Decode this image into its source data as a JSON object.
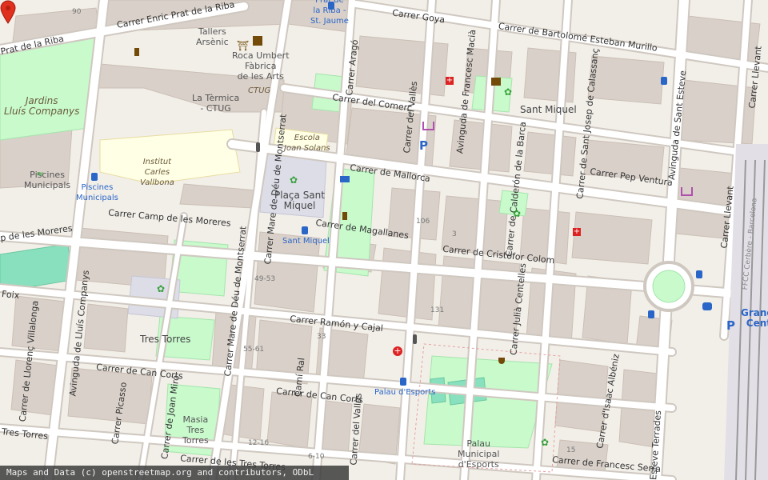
{
  "attribution": "Maps and Data (c) openstreetmap.org and contributors, ODbL",
  "streets": {
    "goya": "Carrer Goya",
    "enric_prat": "Carrer Enric Prat de la Riba",
    "prat_riba_left": "Prat de la Riba",
    "bartolome": "Carrer de Bartolomé Esteban Murillo",
    "comerc": "Carrer del Comerç",
    "mallorca": "Carrer de Mallorca",
    "pep_ventura": "Carrer Pep Ventura",
    "moreres": "Carrer Camp de les Moreres",
    "moreres_left": "p de les Moreres",
    "magallanes": "Carrer de Magallanes",
    "cristofor": "Carrer de Cristòfor Colom",
    "ramon_cajal": "Carrer Ramón y Cajal",
    "can_corts_w": "Carrer de Can Corts",
    "can_corts_e": "Carrer de Can Corts",
    "tres_torres_row": "Carrer de les Tres Torres",
    "tres_torres_left": "Tres Torres",
    "francesc_serra": "Carrer de Francesc Serra",
    "foix": "Foix",
    "arago": "Carrer Aragó",
    "valles_n": "Carrer del Vallès",
    "valles_s": "Carrer del Vallès",
    "macia": "Avinguda de Francesc Macià",
    "calderon": "Carrer de Calderón de la Barca",
    "josep_calassanc": "Carrer de Sant Josep de Calassanç",
    "sant_esteve": "Avinguda de Sant Esteve",
    "llevant_n": "Carrer Llevant",
    "llevant_s": "Carrer Llevant",
    "montserrat_n": "Carrer Mare de Déu de Montserrat",
    "montserrat_s": "Carrer Mare de Déu de Montserrat",
    "cami_ral": "Camí Ral",
    "julia": "Carrer Julià Centelles",
    "isaac": "Carrer d'Isaac Albéniz",
    "joan_miro": "Carrer de Joan Miró",
    "picasso": "Carrer Picasso",
    "lluis_companys": "Avinguda de Lluís Companys",
    "llorenc": "Carrer de Llorenç Villalonga",
    "terrades": "Esteve Terrades"
  },
  "places": {
    "tallers": "Tallers\nArsènic",
    "roca": "Roca Umbert\nFàbrica\nde les Arts",
    "ctug_term": "La Tèrmica\n- CTUG",
    "ctug": "CTUG",
    "jardins": "Jardins\nLluís Companys",
    "escola": "Escola\nJoan Solans",
    "institut": "Institut\nCarles\nVallbona",
    "piscines": "Piscines\nMunicipals",
    "placa": "Plaça Sant\nMiquel",
    "sant_miquel_area": "Sant Miquel",
    "tres_torres": "Tres Torres",
    "masia": "Masia\nTres\nTorres",
    "palau": "Palau\nMunicipal\nd'Esports",
    "granollers": "Granol\nCent"
  },
  "stops": {
    "prat_riba": "Prat de\nla Riba -\nSt. Jaume",
    "piscines": "Piscines\nMunicipals",
    "sant_miquel": "Sant Miquel",
    "palau": "Palau d'Esports"
  },
  "numbers": {
    "n90": "90",
    "n106": "106",
    "n3": "3",
    "n131": "131",
    "n4953": "49-53",
    "n33": "33",
    "n5561": "55-61",
    "n1216": "12-16",
    "n610": "6-10",
    "n15": "15"
  },
  "railway": "FFCC Cerbère - Barcelona",
  "colors": {
    "land": "#f2efe9",
    "building": "#d9d0c9",
    "park": "#c8facc",
    "pitch": "#88e0be",
    "road": "#ffffff",
    "casing": "#cfc8c0",
    "school": "#ffffe5",
    "marker": "#e0301e"
  }
}
